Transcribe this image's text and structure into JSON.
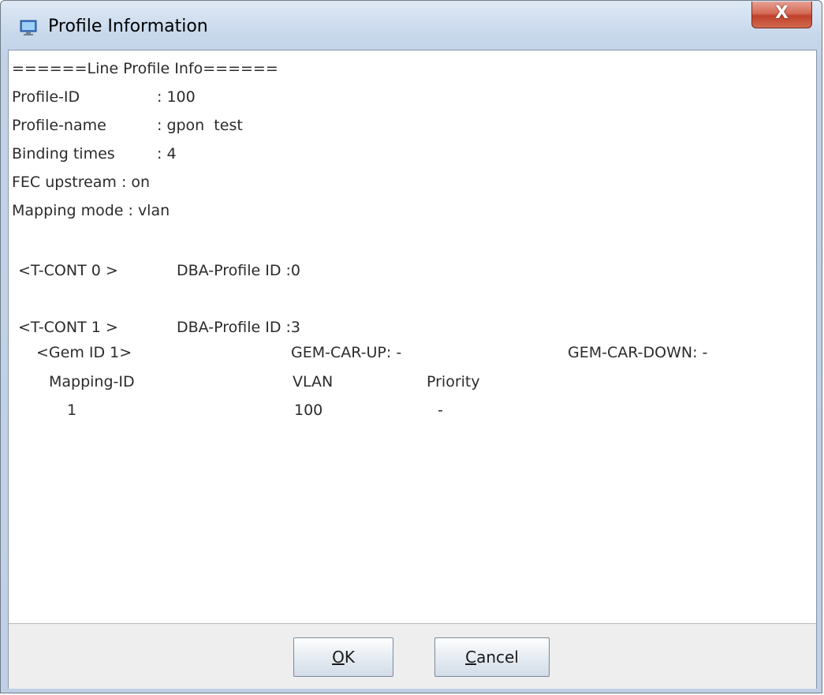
{
  "window": {
    "title": "Profile Information",
    "close_glyph": "X",
    "app_icon": "window-app-icon"
  },
  "info": {
    "header": "======Line Profile Info======",
    "profile_id_label": "Profile-ID",
    "profile_id_value": ": 100",
    "profile_name_label": "Profile-name",
    "profile_name_value": ": gpon  test",
    "binding_times_label": "Binding times",
    "binding_times_value": ": 4",
    "fec_upstream": "FEC upstream : on",
    "mapping_mode": "Mapping mode : vlan",
    "tcont0_label": "<T-CONT 0 >",
    "tcont0_dba": "DBA-Profile ID :0",
    "tcont1_label": "<T-CONT 1 >",
    "tcont1_dba": "DBA-Profile ID :3",
    "gem_label": "<Gem ID 1>",
    "gem_car_up": "GEM-CAR-UP: -",
    "gem_car_down": "GEM-CAR-DOWN: -",
    "col_mapping_id": "Mapping-ID",
    "col_vlan": "VLAN",
    "col_priority": "Priority",
    "row_mapping_id": "1",
    "row_vlan": "100",
    "row_priority": "-"
  },
  "buttons": {
    "ok_mnemonic": "O",
    "ok_rest": "K",
    "cancel_mnemonic": "C",
    "cancel_rest": "ancel"
  }
}
